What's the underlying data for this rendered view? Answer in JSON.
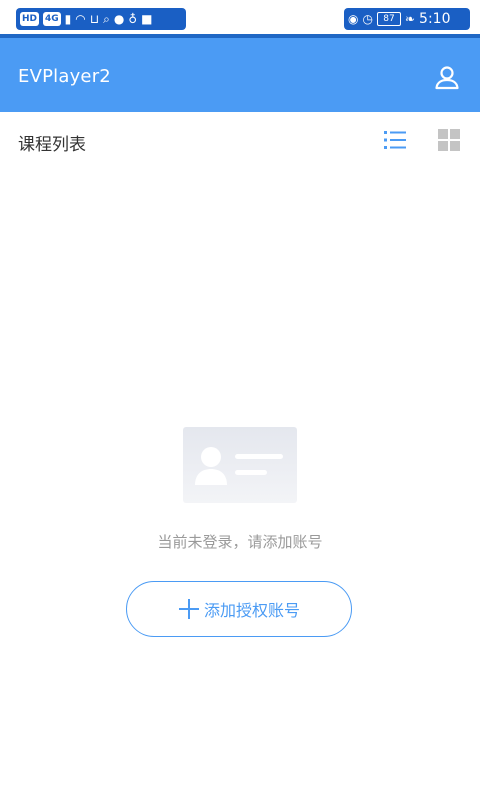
{
  "status_bar": {
    "time": "5:10",
    "battery": "87",
    "network_badges": [
      "HD",
      "4G"
    ]
  },
  "app_bar": {
    "title": "EVPlayer2",
    "user_icon": "user-icon"
  },
  "section": {
    "title": "课程列表",
    "list_view_icon": "list-icon",
    "grid_view_icon": "grid-icon"
  },
  "empty_state": {
    "illustration_icon": "id-card-icon",
    "message": "当前未登录，请添加账号",
    "add_button_label": "添加授权账号",
    "add_button_icon": "plus-icon"
  },
  "colors": {
    "primary": "#4b9bf4",
    "statusbar_accent": "#1a5fc4",
    "muted_text": "#9a9a9a",
    "title_text": "#333333"
  }
}
